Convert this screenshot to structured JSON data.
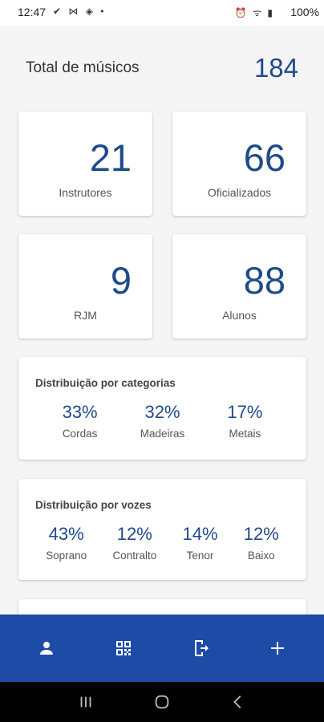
{
  "status_bar": {
    "time": "12:47",
    "left_icons": "✔ ⋈ ◈ •",
    "right_icons": "⏰ ᯤ ▮",
    "battery": "100%"
  },
  "summary": {
    "total_label": "Total de músicos",
    "total_value": "184"
  },
  "stats": [
    {
      "value": "21",
      "label": "Instrutores"
    },
    {
      "value": "66",
      "label": "Oficializados"
    },
    {
      "value": "9",
      "label": "RJM"
    },
    {
      "value": "88",
      "label": "Alunos"
    }
  ],
  "categories": {
    "title": "Distribuição por categorias",
    "items": [
      {
        "pct": "33%",
        "name": "Cordas"
      },
      {
        "pct": "32%",
        "name": "Madeiras"
      },
      {
        "pct": "17%",
        "name": "Metais"
      }
    ]
  },
  "voices": {
    "title": "Distribuição por vozes",
    "items": [
      {
        "pct": "43%",
        "name": "Soprano"
      },
      {
        "pct": "12%",
        "name": "Contralto"
      },
      {
        "pct": "14%",
        "name": "Tenor"
      },
      {
        "pct": "12%",
        "name": "Baixo"
      }
    ]
  },
  "bottom_nav": {
    "icons": [
      "person-icon",
      "qr-code-icon",
      "exit-icon",
      "plus-icon"
    ]
  },
  "colors": {
    "accent": "#1f4a8c",
    "nav_bar": "#1e4ba6"
  }
}
